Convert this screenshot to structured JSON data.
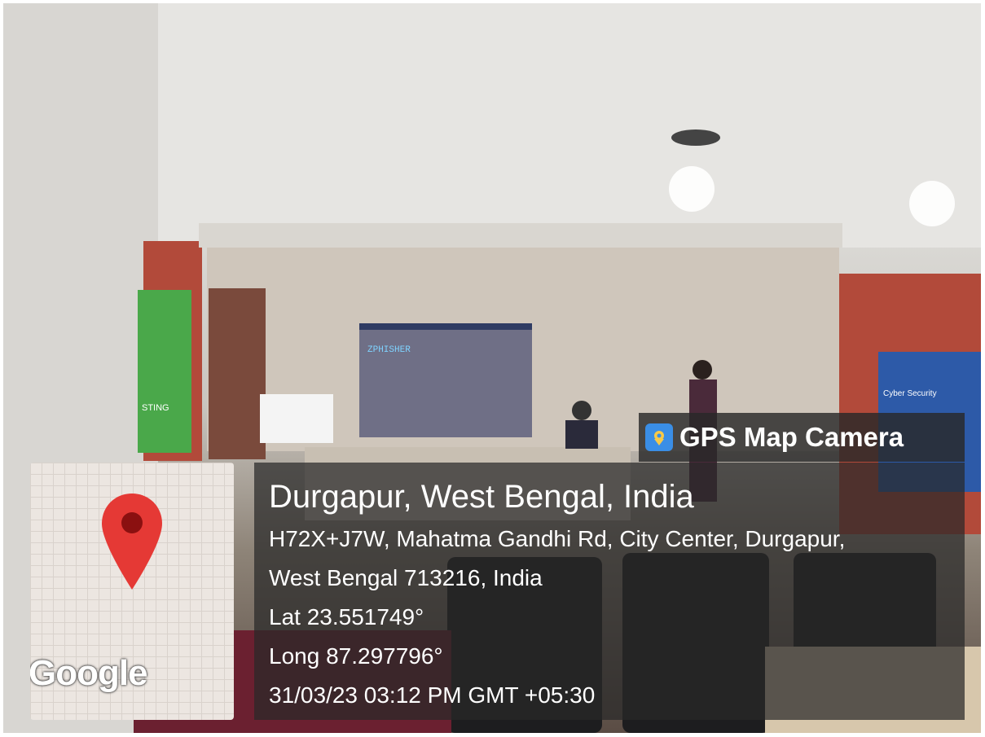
{
  "watermark": {
    "app_name": "GPS Map Camera",
    "icon": "camera-map-pin-icon",
    "map_logo_text": "Google",
    "map_pin_icon": "map-pin-icon",
    "place_name": "Durgapur, West Bengal, India",
    "address_line1": "H72X+J7W, Mahatma Gandhi Rd, City Center, Durgapur,",
    "address_line2": "West Bengal 713216, India",
    "latitude": "Lat 23.551749°",
    "longitude": "Long 87.297796°",
    "timestamp": "31/03/23 03:12 PM GMT +05:30"
  },
  "scene": {
    "screen_text": "ZPHISHER",
    "banner_text": "Cyber Security",
    "left_banner_text": "STING"
  },
  "colors": {
    "overlay_bg": "#282828",
    "pin_red": "#e53935",
    "brick": "#b24a3a",
    "screen_blue": "#6f6f86"
  }
}
